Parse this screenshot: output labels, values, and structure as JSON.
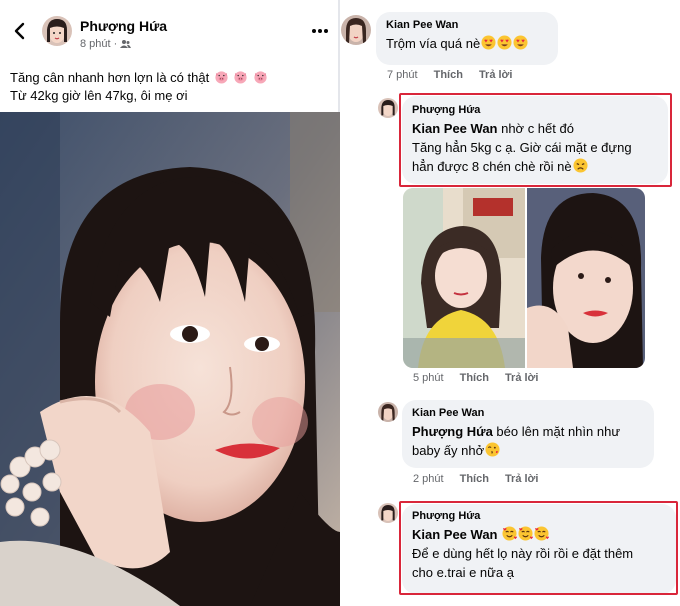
{
  "post": {
    "author": "Phượng Hứa",
    "time": "8 phút",
    "text_line1": "Tăng cân nhanh hơn lợn là có thật",
    "text_line2": "Từ 42kg giờ lên 47kg, ôi mẹ ơi",
    "icons": [
      "back-arrow-icon",
      "friends-audience-icon",
      "more-options-icon",
      "pig-face-emoji"
    ]
  },
  "comments": [
    {
      "author": "Kian Pee Wan",
      "text": "Trộm vía quá nè",
      "time": "7 phút",
      "like": "Thích",
      "reply": "Trả lời"
    },
    {
      "author": "Phượng Hứa",
      "mention": "Kian Pee Wan",
      "line1": " nhờ c hết đó",
      "line2": "Tăng hẳn 5kg c ạ. Giờ cái mặt e đựng",
      "line3": "hẳn được 8 chén chè rồi nè",
      "time": "5 phút",
      "like": "Thích",
      "reply": "Trả lời"
    },
    {
      "author": "Kian Pee Wan",
      "mention": "Phượng Hứa",
      "line1": " béo lên mặt nhìn như",
      "line2": "baby ấy nhở",
      "time": "2 phút",
      "like": "Thích",
      "reply": "Trả lời"
    },
    {
      "author": "Phượng Hứa",
      "mention": "Kian Pee Wan",
      "line2": "Để e dùng hết lọ này rồi rồi e đặt thêm",
      "line3": "cho e.trai e nữa ạ"
    }
  ],
  "colors": {
    "highlight": "#d9263a",
    "bubble": "#f0f2f5",
    "meta": "#65676b"
  }
}
